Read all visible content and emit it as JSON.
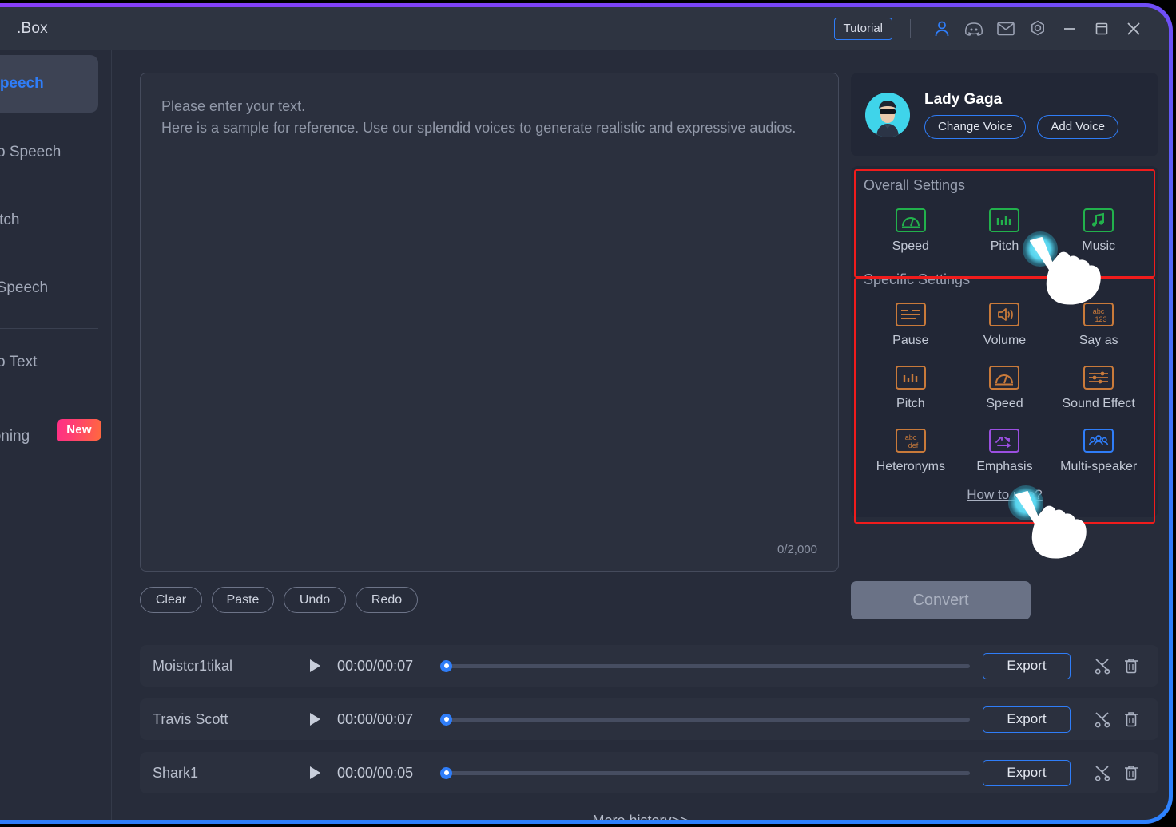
{
  "window": {
    "title": ".Box",
    "frame_gradient_start": "#8a3dfb",
    "frame_gradient_end": "#2d82ff",
    "accent_blue": "#2f7df8",
    "highlight_red": "#f01c1c",
    "overall_icon_color": "#22b14c",
    "specific_icon_color": "#c97a3a"
  },
  "titlebar": {
    "tutorial_label": "Tutorial",
    "icons": [
      {
        "name": "account-icon",
        "glyph": "person"
      },
      {
        "name": "discord-icon",
        "glyph": "discord"
      },
      {
        "name": "mail-icon",
        "glyph": "envelope"
      },
      {
        "name": "settings-icon",
        "glyph": "gear"
      },
      {
        "name": "minimize-icon",
        "glyph": "minus"
      },
      {
        "name": "maximize-icon",
        "glyph": "square"
      },
      {
        "name": "close-icon",
        "glyph": "cross"
      }
    ]
  },
  "sidebar": {
    "items": [
      {
        "label": "Text to Speech",
        "active": true
      },
      {
        "label": "Speech to Speech",
        "active": false
      },
      {
        "label": "Voice Match",
        "active": false
      },
      {
        "label": "Video to Speech",
        "active": false
      },
      {
        "label": "Speech to Text",
        "active": false
      },
      {
        "label": "Voice Cloning",
        "active": false,
        "badge": "New"
      }
    ]
  },
  "editor": {
    "placeholder_line1": "Please enter your text.",
    "placeholder_line2": "Here is a sample for reference. Use our splendid voices to generate realistic and expressive audios.",
    "char_count": "0/2,000",
    "actions": [
      "Clear",
      "Paste",
      "Undo",
      "Redo"
    ]
  },
  "voice_card": {
    "name": "Lady Gaga",
    "change_voice_label": "Change Voice",
    "add_voice_label": "Add Voice"
  },
  "overall_settings": {
    "title": "Overall Settings",
    "items": [
      {
        "label": "Speed",
        "icon": "gauge-icon"
      },
      {
        "label": "Pitch",
        "icon": "bars-icon"
      },
      {
        "label": "Music",
        "icon": "music-note-icon"
      }
    ]
  },
  "specific_settings": {
    "title": "Specific Settings",
    "items": [
      {
        "label": "Pause",
        "icon": "pause-lines-icon",
        "color": "#c97a3a"
      },
      {
        "label": "Volume",
        "icon": "speaker-icon",
        "color": "#c97a3a"
      },
      {
        "label": "Say as",
        "icon": "abc123-icon",
        "color": "#c97a3a"
      },
      {
        "label": "Pitch",
        "icon": "bars-icon",
        "color": "#c97a3a"
      },
      {
        "label": "Speed",
        "icon": "gauge-icon",
        "color": "#c97a3a"
      },
      {
        "label": "Sound Effect",
        "icon": "sliders-icon",
        "color": "#c97a3a"
      },
      {
        "label": "Heteronyms",
        "icon": "abcdef-icon",
        "color": "#c97a3a"
      },
      {
        "label": "Emphasis",
        "icon": "arrows-icon",
        "color": "#9b4fe0"
      },
      {
        "label": "Multi-speaker",
        "icon": "people-icon",
        "color": "#2f7df8"
      }
    ],
    "how_to_use_label": "How to use?"
  },
  "convert": {
    "label": "Convert",
    "enabled": false
  },
  "history": {
    "rows": [
      {
        "name": "Moistcr1tikal",
        "time": "00:00/00:07",
        "export_label": "Export",
        "progress": 0
      },
      {
        "name": "Travis Scott",
        "time": "00:00/00:07",
        "export_label": "Export",
        "progress": 0
      },
      {
        "name": "Shark1",
        "time": "00:00/00:05",
        "export_label": "Export",
        "progress": 0
      }
    ],
    "more_label": "More history>>",
    "cut_icon": "scissors-icon",
    "delete_icon": "trash-icon",
    "play_icon": "play-icon"
  }
}
